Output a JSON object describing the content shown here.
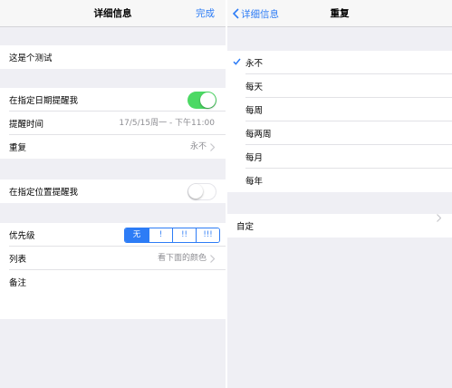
{
  "left": {
    "nav": {
      "title": "详细信息",
      "done": "完成"
    },
    "title_row": {
      "text": "这是个测试"
    },
    "remind_date": {
      "label": "在指定日期提醒我",
      "toggle_on": true
    },
    "remind_time": {
      "label": "提醒时间",
      "value": "17/5/15周一 - 下午11:00"
    },
    "repeat": {
      "label": "重复",
      "value": "永不"
    },
    "remind_location": {
      "label": "在指定位置提醒我",
      "toggle_on": false
    },
    "priority": {
      "label": "优先级",
      "options": [
        "无",
        "!",
        "!!",
        "!!!"
      ],
      "selected": "无"
    },
    "list": {
      "label": "列表",
      "value": "看下面的颜色"
    },
    "notes": {
      "label": "备注"
    }
  },
  "right": {
    "nav": {
      "back": "详细信息",
      "title": "重复"
    },
    "options": [
      "永不",
      "每天",
      "每周",
      "每两周",
      "每月",
      "每年"
    ],
    "selected": "永不",
    "custom": {
      "label": "自定"
    }
  },
  "colors": {
    "accent": "#2d7cf6",
    "toggle_on": "#4cd964",
    "background": "#efeff4"
  }
}
